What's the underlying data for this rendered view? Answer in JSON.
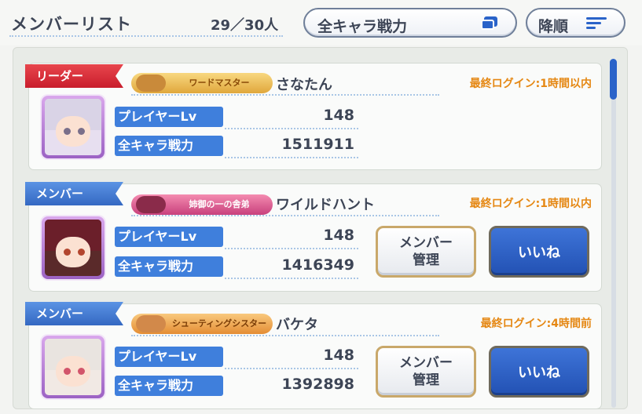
{
  "header": {
    "title": "メンバーリスト",
    "count": "29／30人",
    "sort_select_label": "全キャラ戦力",
    "sort_order_label": "降順"
  },
  "members": [
    {
      "role": "リーダー",
      "title_badge": "ワードマスター",
      "name": "さなたん",
      "last_login": "最終ログイン:1時間以内",
      "level_label": "プレイヤーLv",
      "level": "148",
      "power_label": "全キャラ戦力",
      "power": "1511911"
    },
    {
      "role": "メンバー",
      "title_badge": "姉御の一の舎弟",
      "name": "ワイルドハント",
      "last_login": "最終ログイン:1時間以内",
      "level_label": "プレイヤーLv",
      "level": "148",
      "power_label": "全キャラ戦力",
      "power": "1416349",
      "manage_label": "メンバー\n管理",
      "like_label": "いいね"
    },
    {
      "role": "メンバー",
      "title_badge": "シューティングシスター",
      "name": "バケタ",
      "last_login": "最終ログイン:4時間前",
      "level_label": "プレイヤーLv",
      "level": "148",
      "power_label": "全キャラ戦力",
      "power": "1392898",
      "manage_label": "メンバー\n管理",
      "like_label": "いいね"
    }
  ],
  "colors": {
    "accent_blue": "#2a63c9",
    "leader_red": "#d62a37",
    "login_orange": "#e58814",
    "text_dark": "#3d4556"
  },
  "icons": {
    "sort_select": "copy-icon",
    "sort_order": "sort-lines-icon"
  }
}
